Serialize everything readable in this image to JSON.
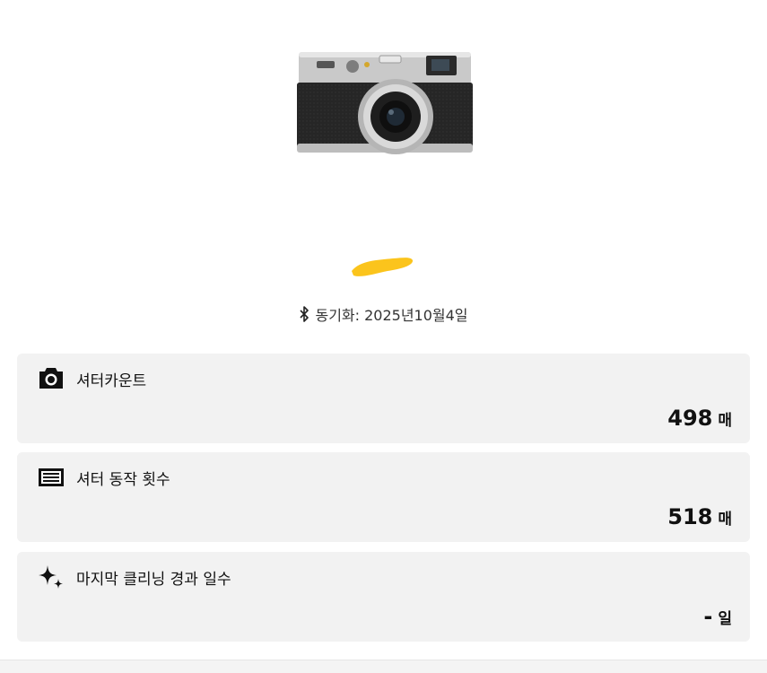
{
  "device": {
    "image_icon": "camera-product-image",
    "sync_icon": "bluetooth-icon",
    "sync_text": "동기화: 2025년10월4일"
  },
  "cards": [
    {
      "icon": "camera-icon",
      "title": "셔터카운트",
      "value": "498",
      "unit": "매"
    },
    {
      "icon": "shutter-icon",
      "title": "셔터 동작 횟수",
      "value": "518",
      "unit": "매"
    },
    {
      "icon": "sparkle-icon",
      "title": "마지막 클리닝 경과 일수",
      "value": "-",
      "unit": "일"
    }
  ],
  "colors": {
    "card_bg": "#f2f2f2",
    "redaction": "#fbc41c"
  }
}
